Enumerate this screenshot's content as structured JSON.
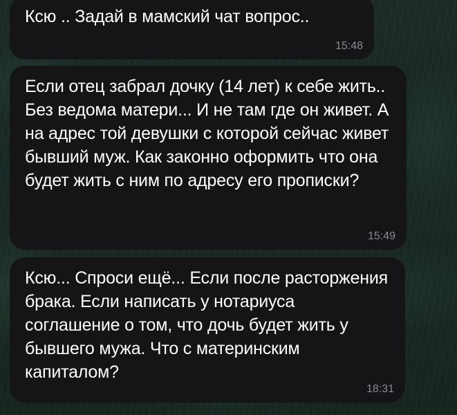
{
  "chat": {
    "messages": [
      {
        "text": "Ксю .. Задай в мамский чат вопрос..",
        "time": "15:48"
      },
      {
        "text": "Если отец забрал дочку (14 лет) к себе жить.. Без ведома матери... И не там где он живет. А на адрес той девушки с которой сейчас живет бывший муж. Как законно оформить что она будет жить с ним по адресу его прописки?",
        "time": "15:49"
      },
      {
        "text": "Ксю... Спроси ещё... Если после расторжения брака. Если написать у нотариуса соглашение о том, что дочь будет жить у бывшего мужа. Что с материнским капиталом?",
        "time": "18:31"
      }
    ]
  },
  "colors": {
    "bubble": "#151517",
    "text": "#ffffff",
    "timestamp": "#8a8a8f"
  }
}
